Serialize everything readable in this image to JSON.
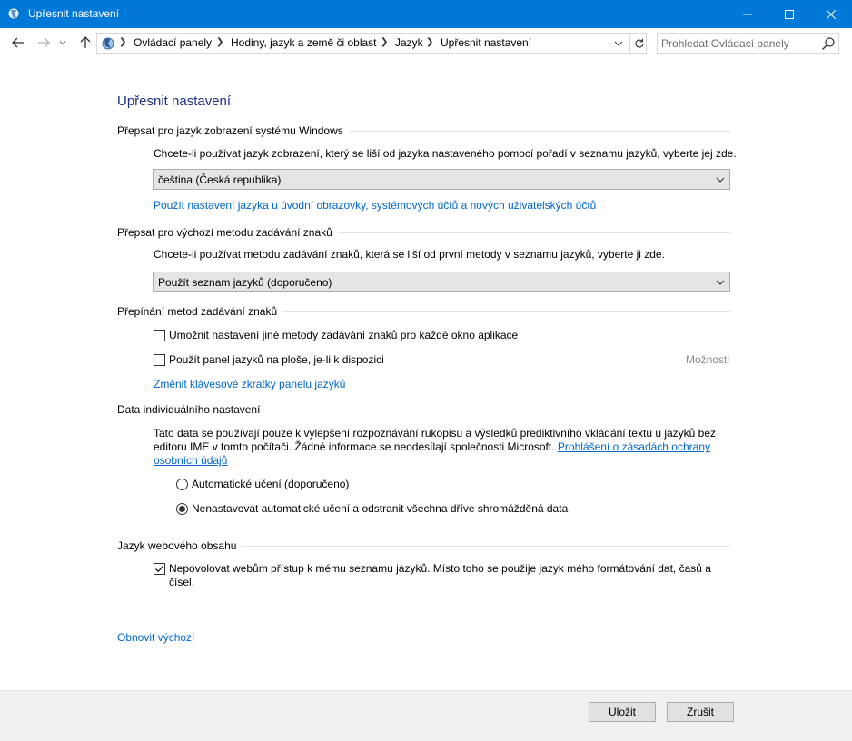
{
  "window": {
    "title": "Upřesnit nastavení"
  },
  "breadcrumb": [
    "Ovládací panely",
    "Hodiny, jazyk a země či oblast",
    "Jazyk",
    "Upřesnit nastavení"
  ],
  "search": {
    "placeholder": "Prohledat Ovládací panely"
  },
  "page_title": "Upřesnit nastavení",
  "display_lang": {
    "heading": "Přepsat pro jazyk zobrazení systému Windows",
    "description": "Chcete-li používat jazyk zobrazení, který se liší od jazyka nastaveného pomocí pořadí v seznamu jazyků, vyberte jej zde.",
    "selected": "čeština (Česká republika)",
    "link": "Použít nastavení jazyka u úvodní obrazovky, systémových účtů a nových uživatelských účtů"
  },
  "input_method": {
    "heading": "Přepsat pro výchozí metodu zadávání znaků",
    "description": "Chcete-li používat metodu zadávání znaků, která se liší od první metody v seznamu jazyků, vyberte ji zde.",
    "selected": "Použít seznam jazyků (doporučeno)"
  },
  "switching": {
    "heading": "Přepínání metod zadávání znaků",
    "option1": "Umožnit nastavení jiné metody zadávání znaků pro každé okno aplikace",
    "option1_checked": false,
    "option2": "Použít panel jazyků na ploše, je-li k dispozici",
    "option2_checked": false,
    "options_link": "Možnosti",
    "hotkeys_link": "Změnit klávesové zkratky panelu jazyků"
  },
  "personalization": {
    "heading": "Data individuálního nastavení",
    "description_line1": "Tato data se používají pouze k vylepšení rozpoznávání rukopisu a výsledků prediktivního vkládání textu u jazyků bez",
    "description_line2": "editoru IME v tomto počítači. Žádné informace se neodesílají společnosti Microsoft.",
    "privacy_link_part1": "Prohlášení o zásadách ochrany",
    "privacy_link_part2": "osobních údajů",
    "radio1": "Automatické učení (doporučeno)",
    "radio2": "Nenastavovat automatické učení a odstranit všechna dříve shromážděná data",
    "selected_radio": 2
  },
  "web_content": {
    "heading": "Jazyk webového obsahu",
    "option_line1": "Nepovolovat webům přístup k mému seznamu jazyků. Místo toho se použije jazyk mého formátování dat, časů a",
    "option_line2": "čísel.",
    "checked": true
  },
  "restore_link": "Obnovit výchozí",
  "buttons": {
    "save": "Uložit",
    "cancel": "Zrušit"
  },
  "colors": {
    "titlebar": "#0078d7",
    "link": "#0066cc",
    "heading": "#1e3287"
  }
}
